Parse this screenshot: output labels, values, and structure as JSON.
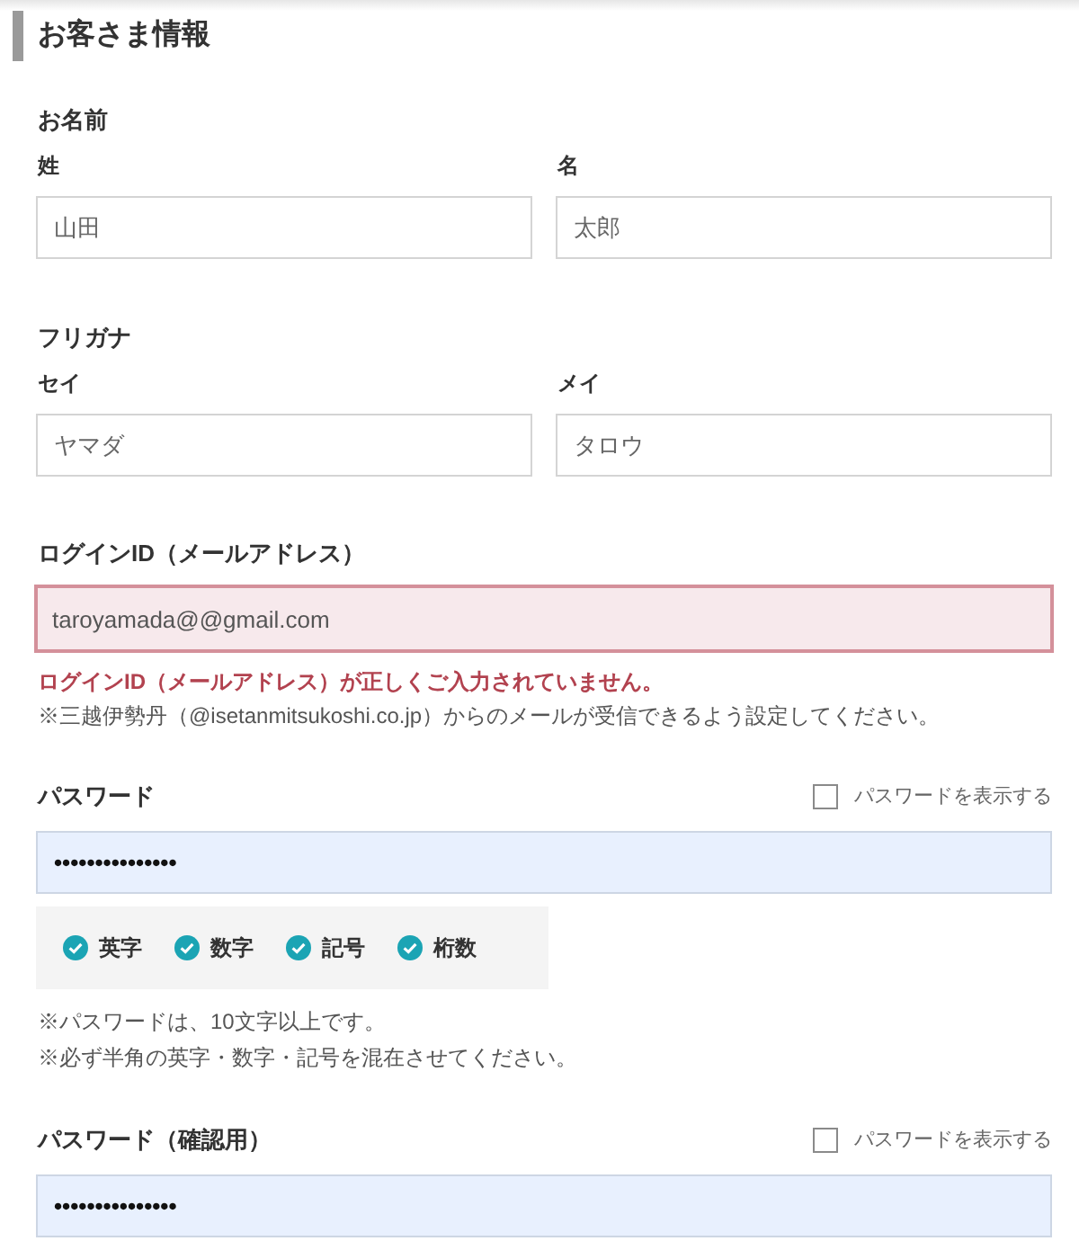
{
  "section": {
    "title": "お客さま情報"
  },
  "name_groups": [
    {
      "label": "お名前",
      "fields": [
        {
          "label": "姓",
          "value": "山田"
        },
        {
          "label": "名",
          "value": "太郎"
        }
      ]
    },
    {
      "label": "フリガナ",
      "fields": [
        {
          "label": "セイ",
          "value": "ヤマダ"
        },
        {
          "label": "メイ",
          "value": "タロウ"
        }
      ]
    }
  ],
  "login_id": {
    "label": "ログインID（メールアドレス）",
    "value": "taroyamada@@gmail.com",
    "error": true,
    "error_message": "ログインID（メールアドレス）が正しくご入力されていません。",
    "note": "※三越伊勢丹（@isetanmitsukoshi.co.jp）からのメールが受信できるよう設定してください。"
  },
  "password": {
    "label": "パスワード",
    "show_toggle": {
      "label": "パスワードを表示する",
      "checked": false
    },
    "value": "•••••••••••••••",
    "autofilled": true,
    "requirements": [
      {
        "label": "英字",
        "checked": true
      },
      {
        "label": "数字",
        "checked": true
      },
      {
        "label": "記号",
        "checked": true
      },
      {
        "label": "桁数",
        "checked": true
      }
    ],
    "notes": [
      "※パスワードは、10文字以上です。",
      "※必ず半角の英字・数字・記号を混在させてください。"
    ]
  },
  "password_confirm": {
    "label": "パスワード（確認用）",
    "show_toggle": {
      "label": "パスワードを表示する",
      "checked": false
    },
    "value": "•••••••••••••••",
    "autofilled": true
  }
}
